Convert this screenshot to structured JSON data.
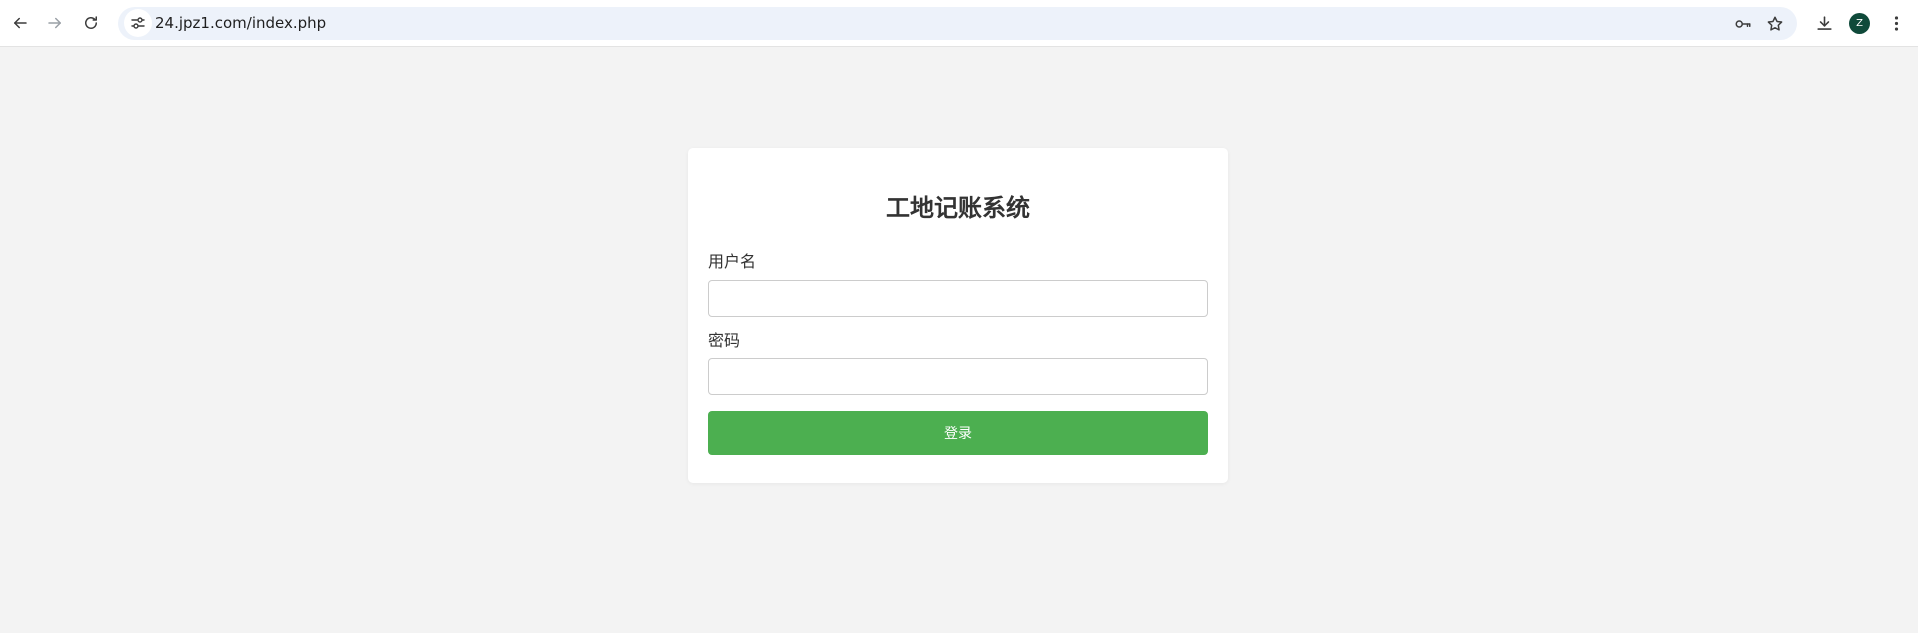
{
  "browser": {
    "url": "24.jpz1.com/index.php",
    "avatar_initial": "Z"
  },
  "login": {
    "title": "工地记账系统",
    "username_label": "用户名",
    "username_value": "",
    "password_label": "密码",
    "password_value": "",
    "submit_label": "登录"
  },
  "colors": {
    "page_bg": "#f3f3f3",
    "card_bg": "#ffffff",
    "button_bg": "#4caf50",
    "omnibox_bg": "#edf2fa"
  }
}
